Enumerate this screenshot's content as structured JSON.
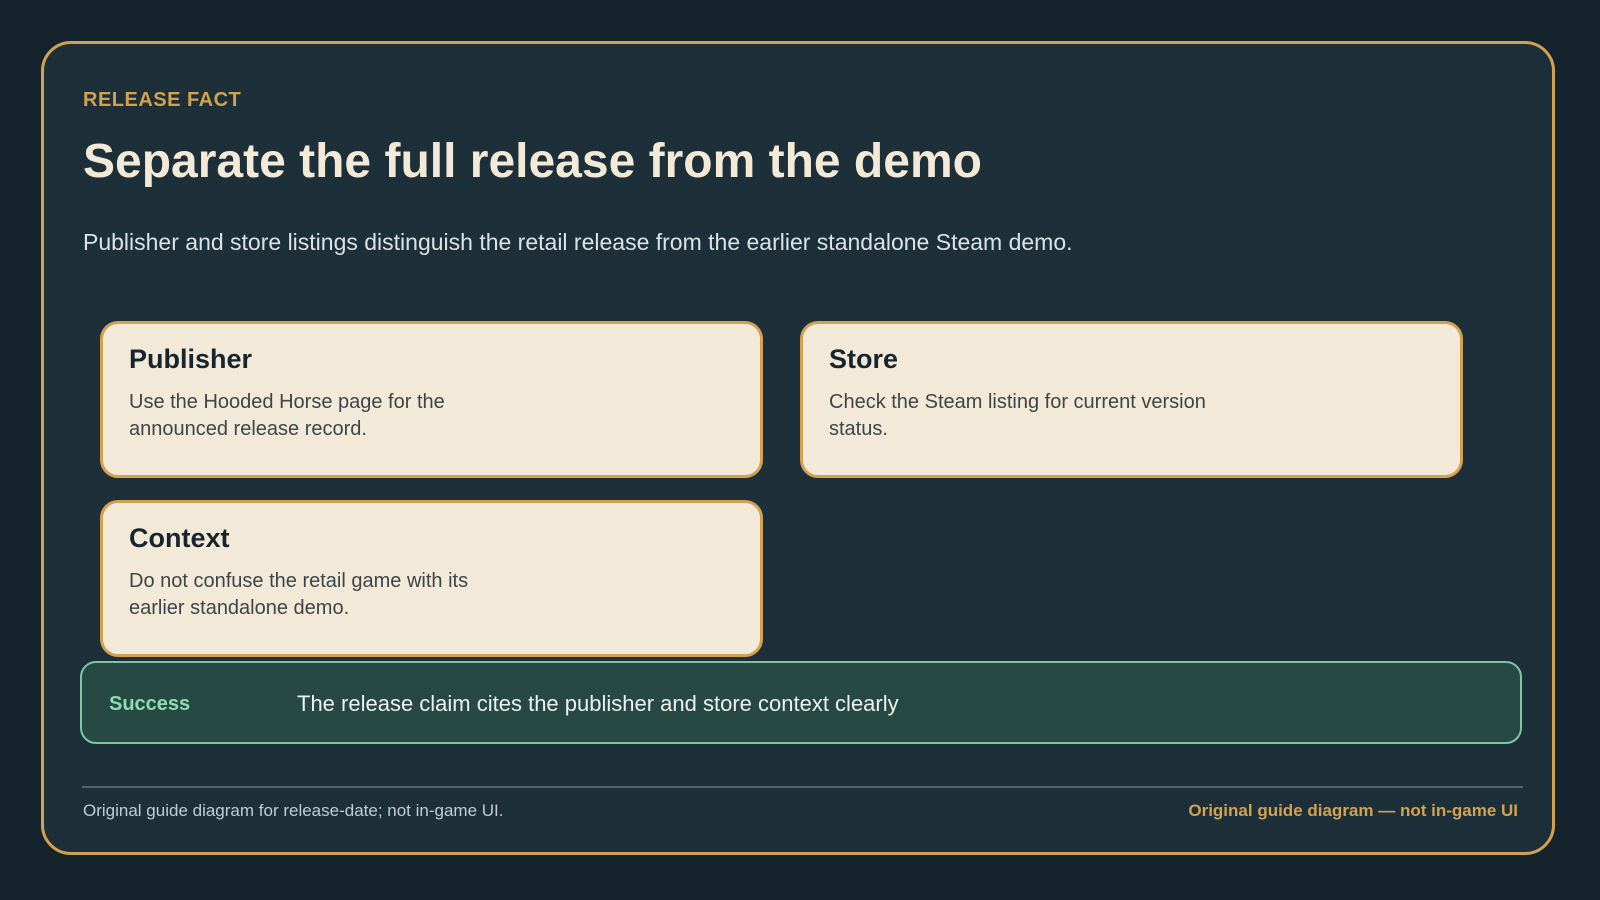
{
  "header": {
    "eyebrow": "RELEASE FACT",
    "title": "Separate the full release from the demo",
    "subtitle": "Publisher and store listings distinguish the retail release from the earlier standalone Steam demo."
  },
  "cards": [
    {
      "title": "Publisher",
      "body": "Use the Hooded Horse page for the announced release record."
    },
    {
      "title": "Store",
      "body": "Check the Steam listing for current version status."
    },
    {
      "title": "Context",
      "body": "Do not confuse the retail game with its earlier standalone demo."
    }
  ],
  "status": {
    "label": "Success",
    "message": "The release claim cites the publisher and store context clearly"
  },
  "footer": {
    "left": "Original guide diagram for release-date; not in-game UI.",
    "right": "Original guide diagram — not in-game UI"
  },
  "colors": {
    "background": "#15232c",
    "panel": "#1d2f39",
    "accent": "#d3a24f",
    "card": "#f3e9d8",
    "success_fill": "#264a43",
    "success_border": "#7cc7a3",
    "success_text": "#8fdcb0"
  }
}
